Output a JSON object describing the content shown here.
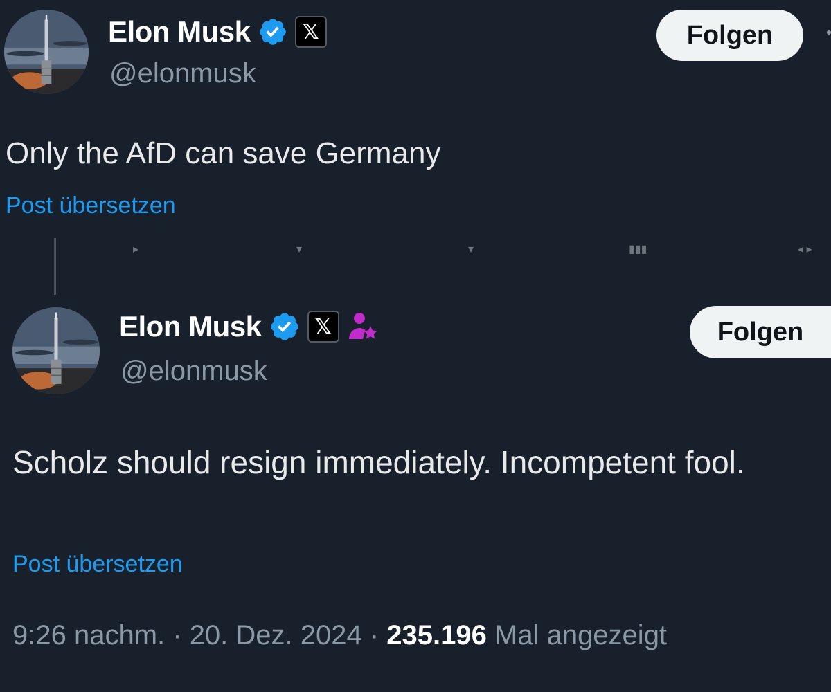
{
  "tweet1": {
    "display_name": "Elon Musk",
    "handle": "@elonmusk",
    "follow_label": "Folgen",
    "text": "Only the AfD can save Germany",
    "translate_label": "Post übersetzen",
    "badges": [
      "verified-icon",
      "x-badge-icon"
    ]
  },
  "tweet2": {
    "display_name": "Elon Musk",
    "handle": "@elonmusk",
    "follow_label": "Folgen",
    "text": "Scholz should resign immediately. Incompetent fool.",
    "translate_label": "Post übersetzen",
    "badges": [
      "verified-icon",
      "x-badge-icon",
      "affiliate-icon"
    ],
    "meta": {
      "time": "9:26 nachm.",
      "sep1": " · ",
      "date": "20. Dez. 2024",
      "sep2": " · ",
      "views_count": "235.196",
      "views_label": " Mal angezeigt"
    }
  },
  "colors": {
    "background": "#18202b",
    "link": "#1d9bf0",
    "verified": "#1d9bf0",
    "affiliate": "#c02cc9",
    "follow_bg": "#eff3f4"
  }
}
